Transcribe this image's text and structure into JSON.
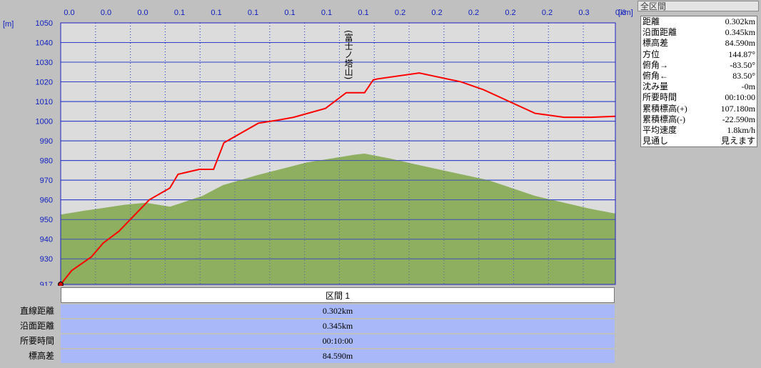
{
  "units": {
    "y": "[m]",
    "x": "[km]"
  },
  "chart_data": {
    "type": "area",
    "x_tick_labels": [
      "0.0",
      "0.0",
      "0.0",
      "0.1",
      "0.1",
      "0.1",
      "0.1",
      "0.1",
      "0.1",
      "0.2",
      "0.2",
      "0.2",
      "0.2",
      "0.2",
      "0.3",
      "0.3"
    ],
    "y_tick_labels": [
      "917",
      "930",
      "940",
      "950",
      "960",
      "970",
      "980",
      "990",
      "1000",
      "1010",
      "1020",
      "1030",
      "1040",
      "1050"
    ],
    "xlim": [
      0,
      0.345
    ],
    "ylim": [
      917,
      1050
    ],
    "grid": true,
    "annotation": "(富士ノ塔山)",
    "annotation_x": 0.179,
    "series": [
      {
        "color": "#ff0000",
        "x": [
          0,
          0.0068,
          0.0191,
          0.0264,
          0.0362,
          0.0551,
          0.0679,
          0.073,
          0.0862,
          0.0911,
          0.0951,
          0.1015,
          0.123,
          0.1348,
          0.1449,
          0.1647,
          0.1776,
          0.189,
          0.1944,
          0.197,
          0.223,
          0.249,
          0.263,
          0.295,
          0.313,
          0.33,
          0.345
        ],
        "y": [
          917,
          924,
          931,
          938,
          944,
          960,
          966,
          973,
          975.5,
          975.5,
          975.5,
          989,
          999,
          1000.5,
          1002,
          1006.5,
          1014.5,
          1014.5,
          1021,
          1021.5,
          1024.5,
          1020,
          1016,
          1004,
          1002,
          1002,
          1002.5
        ]
      },
      {
        "color": "#8eaf5f",
        "x": [
          0,
          0.015,
          0.04,
          0.053,
          0.068,
          0.0882,
          0.101,
          0.122,
          0.153,
          0.1832,
          0.189,
          0.205,
          0.221,
          0.266,
          0.295,
          0.329,
          0.345
        ],
        "y": [
          952.5,
          954.5,
          957.5,
          958.5,
          956.5,
          962,
          967.5,
          972.5,
          979,
          983,
          983.5,
          981,
          978,
          970,
          962,
          955.5,
          953
        ]
      }
    ]
  },
  "summary": {
    "title": "全区間",
    "rows": [
      {
        "label": "距離",
        "value": "0.302km"
      },
      {
        "label": "沿面距離",
        "value": "0.345km"
      },
      {
        "label": "標高差",
        "value": "84.590m"
      },
      {
        "label": "方位",
        "value": "144.87°"
      },
      {
        "label": "俯角→",
        "value": "-83.50°"
      },
      {
        "label": "俯角←",
        "value": "83.50°"
      },
      {
        "label": "沈み量",
        "value": "-0m"
      },
      {
        "label": "所要時間",
        "value": "00:10:00"
      },
      {
        "label": "累積標高(+)",
        "value": "107.180m"
      },
      {
        "label": "累積標高(-)",
        "value": "-22.590m"
      },
      {
        "label": "平均速度",
        "value": "1.8km/h"
      },
      {
        "label": "見通し",
        "value": "見えます"
      }
    ]
  },
  "segment": {
    "header": "区間 1",
    "rows": [
      {
        "label": "直線距離",
        "value": "0.302km"
      },
      {
        "label": "沿面距離",
        "value": "0.345km"
      },
      {
        "label": "所要時間",
        "value": "00:10:00"
      },
      {
        "label": "標高差",
        "value": "84.590m"
      }
    ]
  }
}
